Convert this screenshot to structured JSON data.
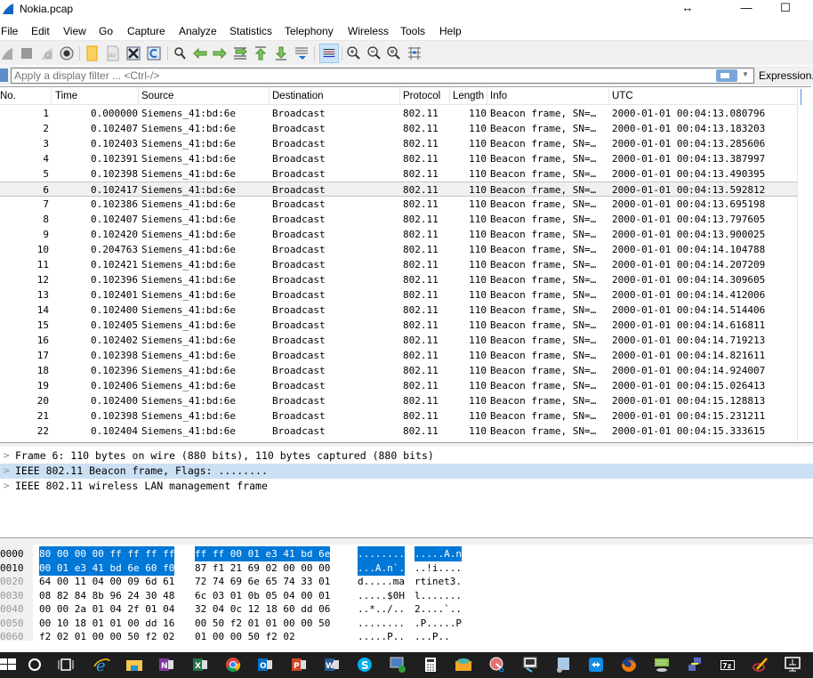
{
  "window": {
    "title": "Nokia.pcap",
    "controls": {
      "resize_glyph": "↔",
      "minimize_glyph": "—",
      "maximize_glyph": "☐"
    }
  },
  "menu": [
    "File",
    "Edit",
    "View",
    "Go",
    "Capture",
    "Analyze",
    "Statistics",
    "Telephony",
    "Wireless",
    "Tools",
    "Help"
  ],
  "toolbar": {
    "icons": [
      "start-capture-icon",
      "stop-capture-icon",
      "restart-capture-icon",
      "capture-options-icon",
      "open-file-icon",
      "save-file-icon",
      "close-file-icon",
      "reload-file-icon",
      "find-packet-icon",
      "go-back-icon",
      "go-forward-icon",
      "go-to-packet-icon",
      "first-packet-icon",
      "last-packet-icon",
      "auto-scroll-icon",
      "colorize-icon",
      "zoom-in-icon",
      "zoom-out-icon",
      "normal-size-icon",
      "resize-columns-icon"
    ]
  },
  "filter": {
    "placeholder": "Apply a display filter ... <Ctrl-/>",
    "value": "",
    "expression_label": "Expression..."
  },
  "packet_list": {
    "columns": [
      "No.",
      "Time",
      "Source",
      "Destination",
      "Protocol",
      "Length",
      "Info",
      "UTC"
    ],
    "selected_index": 5,
    "rows": [
      {
        "no": "1",
        "time": "0.000000",
        "source": "Siemens_41:bd:6e",
        "destination": "Broadcast",
        "protocol": "802.11",
        "length": "110",
        "info": "Beacon frame, SN=…",
        "utc": "2000-01-01 00:04:13.080796"
      },
      {
        "no": "2",
        "time": "0.102407",
        "source": "Siemens_41:bd:6e",
        "destination": "Broadcast",
        "protocol": "802.11",
        "length": "110",
        "info": "Beacon frame, SN=…",
        "utc": "2000-01-01 00:04:13.183203"
      },
      {
        "no": "3",
        "time": "0.102403",
        "source": "Siemens_41:bd:6e",
        "destination": "Broadcast",
        "protocol": "802.11",
        "length": "110",
        "info": "Beacon frame, SN=…",
        "utc": "2000-01-01 00:04:13.285606"
      },
      {
        "no": "4",
        "time": "0.102391",
        "source": "Siemens_41:bd:6e",
        "destination": "Broadcast",
        "protocol": "802.11",
        "length": "110",
        "info": "Beacon frame, SN=…",
        "utc": "2000-01-01 00:04:13.387997"
      },
      {
        "no": "5",
        "time": "0.102398",
        "source": "Siemens_41:bd:6e",
        "destination": "Broadcast",
        "protocol": "802.11",
        "length": "110",
        "info": "Beacon frame, SN=…",
        "utc": "2000-01-01 00:04:13.490395"
      },
      {
        "no": "6",
        "time": "0.102417",
        "source": "Siemens_41:bd:6e",
        "destination": "Broadcast",
        "protocol": "802.11",
        "length": "110",
        "info": "Beacon frame, SN=…",
        "utc": "2000-01-01 00:04:13.592812"
      },
      {
        "no": "7",
        "time": "0.102386",
        "source": "Siemens_41:bd:6e",
        "destination": "Broadcast",
        "protocol": "802.11",
        "length": "110",
        "info": "Beacon frame, SN=…",
        "utc": "2000-01-01 00:04:13.695198"
      },
      {
        "no": "8",
        "time": "0.102407",
        "source": "Siemens_41:bd:6e",
        "destination": "Broadcast",
        "protocol": "802.11",
        "length": "110",
        "info": "Beacon frame, SN=…",
        "utc": "2000-01-01 00:04:13.797605"
      },
      {
        "no": "9",
        "time": "0.102420",
        "source": "Siemens_41:bd:6e",
        "destination": "Broadcast",
        "protocol": "802.11",
        "length": "110",
        "info": "Beacon frame, SN=…",
        "utc": "2000-01-01 00:04:13.900025"
      },
      {
        "no": "10",
        "time": "0.204763",
        "source": "Siemens_41:bd:6e",
        "destination": "Broadcast",
        "protocol": "802.11",
        "length": "110",
        "info": "Beacon frame, SN=…",
        "utc": "2000-01-01 00:04:14.104788"
      },
      {
        "no": "11",
        "time": "0.102421",
        "source": "Siemens_41:bd:6e",
        "destination": "Broadcast",
        "protocol": "802.11",
        "length": "110",
        "info": "Beacon frame, SN=…",
        "utc": "2000-01-01 00:04:14.207209"
      },
      {
        "no": "12",
        "time": "0.102396",
        "source": "Siemens_41:bd:6e",
        "destination": "Broadcast",
        "protocol": "802.11",
        "length": "110",
        "info": "Beacon frame, SN=…",
        "utc": "2000-01-01 00:04:14.309605"
      },
      {
        "no": "13",
        "time": "0.102401",
        "source": "Siemens_41:bd:6e",
        "destination": "Broadcast",
        "protocol": "802.11",
        "length": "110",
        "info": "Beacon frame, SN=…",
        "utc": "2000-01-01 00:04:14.412006"
      },
      {
        "no": "14",
        "time": "0.102400",
        "source": "Siemens_41:bd:6e",
        "destination": "Broadcast",
        "protocol": "802.11",
        "length": "110",
        "info": "Beacon frame, SN=…",
        "utc": "2000-01-01 00:04:14.514406"
      },
      {
        "no": "15",
        "time": "0.102405",
        "source": "Siemens_41:bd:6e",
        "destination": "Broadcast",
        "protocol": "802.11",
        "length": "110",
        "info": "Beacon frame, SN=…",
        "utc": "2000-01-01 00:04:14.616811"
      },
      {
        "no": "16",
        "time": "0.102402",
        "source": "Siemens_41:bd:6e",
        "destination": "Broadcast",
        "protocol": "802.11",
        "length": "110",
        "info": "Beacon frame, SN=…",
        "utc": "2000-01-01 00:04:14.719213"
      },
      {
        "no": "17",
        "time": "0.102398",
        "source": "Siemens_41:bd:6e",
        "destination": "Broadcast",
        "protocol": "802.11",
        "length": "110",
        "info": "Beacon frame, SN=…",
        "utc": "2000-01-01 00:04:14.821611"
      },
      {
        "no": "18",
        "time": "0.102396",
        "source": "Siemens_41:bd:6e",
        "destination": "Broadcast",
        "protocol": "802.11",
        "length": "110",
        "info": "Beacon frame, SN=…",
        "utc": "2000-01-01 00:04:14.924007"
      },
      {
        "no": "19",
        "time": "0.102406",
        "source": "Siemens_41:bd:6e",
        "destination": "Broadcast",
        "protocol": "802.11",
        "length": "110",
        "info": "Beacon frame, SN=…",
        "utc": "2000-01-01 00:04:15.026413"
      },
      {
        "no": "20",
        "time": "0.102400",
        "source": "Siemens_41:bd:6e",
        "destination": "Broadcast",
        "protocol": "802.11",
        "length": "110",
        "info": "Beacon frame, SN=…",
        "utc": "2000-01-01 00:04:15.128813"
      },
      {
        "no": "21",
        "time": "0.102398",
        "source": "Siemens_41:bd:6e",
        "destination": "Broadcast",
        "protocol": "802.11",
        "length": "110",
        "info": "Beacon frame, SN=…",
        "utc": "2000-01-01 00:04:15.231211"
      },
      {
        "no": "22",
        "time": "0.102404",
        "source": "Siemens_41:bd:6e",
        "destination": "Broadcast",
        "protocol": "802.11",
        "length": "110",
        "info": "Beacon frame, SN=…",
        "utc": "2000-01-01 00:04:15.333615"
      }
    ]
  },
  "details": [
    {
      "text": "Frame 6: 110 bytes on wire (880 bits), 110 bytes captured (880 bits)",
      "selected": false
    },
    {
      "text": "IEEE 802.11 Beacon frame, Flags: ........",
      "selected": true
    },
    {
      "text": "IEEE 802.11 wireless LAN management frame",
      "selected": false
    }
  ],
  "bytes": [
    {
      "offset": "0000",
      "hex_a": "80 00 00 00 ff ff ff ff",
      "hex_b": "ff ff 00 01 e3 41 bd 6e",
      "ascii_a": "........",
      "ascii_b": ".....A.n",
      "hl_hex_a": true,
      "hl_hex_b": true,
      "hl_asc_a": true,
      "hl_asc_b": true
    },
    {
      "offset": "0010",
      "hex_a": "00 01 e3 41 bd 6e 60 f0",
      "hex_b": "87 f1 21 69 02 00 00 00",
      "ascii_a": "...A.n`.",
      "ascii_b": "..!i....",
      "hl_hex_a": true,
      "hl_hex_b": false,
      "hl_asc_a": true,
      "hl_asc_b": false
    },
    {
      "offset": "0020",
      "hex_a": "64 00 11 04 00 09 6d 61",
      "hex_b": "72 74 69 6e 65 74 33 01",
      "ascii_a": "d.....ma",
      "ascii_b": "rtinet3.",
      "hl_hex_a": false,
      "hl_hex_b": false,
      "hl_asc_a": false,
      "hl_asc_b": false
    },
    {
      "offset": "0030",
      "hex_a": "08 82 84 8b 96 24 30 48",
      "hex_b": "6c 03 01 0b 05 04 00 01",
      "ascii_a": ".....$0H",
      "ascii_b": "l.......",
      "hl_hex_a": false,
      "hl_hex_b": false,
      "hl_asc_a": false,
      "hl_asc_b": false
    },
    {
      "offset": "0040",
      "hex_a": "00 00 2a 01 04 2f 01 04",
      "hex_b": "32 04 0c 12 18 60 dd 06",
      "ascii_a": "..*../..",
      "ascii_b": "2....`..",
      "hl_hex_a": false,
      "hl_hex_b": false,
      "hl_asc_a": false,
      "hl_asc_b": false
    },
    {
      "offset": "0050",
      "hex_a": "00 10 18 01 01 00 dd 16",
      "hex_b": "00 50 f2 01 01 00 00 50",
      "ascii_a": "........",
      "ascii_b": ".P.....P",
      "hl_hex_a": false,
      "hl_hex_b": false,
      "hl_asc_a": false,
      "hl_asc_b": false
    },
    {
      "offset": "0060",
      "hex_a": "f2 02 01 00 00 50 f2 02",
      "hex_b": "01 00 00 50 f2 02",
      "ascii_a": ".....P..",
      "ascii_b": "...P..",
      "hl_hex_a": false,
      "hl_hex_b": false,
      "hl_asc_a": false,
      "hl_asc_b": false
    }
  ],
  "taskbar": {
    "icons": [
      "windows-start-icon",
      "cortana-search-icon",
      "task-view-icon",
      "internet-explorer-icon",
      "file-explorer-icon",
      "onenote-icon",
      "excel-icon",
      "chrome-icon",
      "outlook-icon",
      "powerpoint-icon",
      "word-icon",
      "skype-icon",
      "remote-desktop-icon",
      "calculator-icon",
      "folder-app-icon",
      "snipping-tool-icon",
      "network-tool-icon",
      "file-tool-icon",
      "teamviewer-icon",
      "firefox-icon",
      "keyboard-app-icon",
      "network-connect-icon",
      "7zip-icon",
      "paint-tool-icon",
      "network-display-icon"
    ]
  },
  "colors": {
    "selection_blue": "#0078d7",
    "details_selected": "#cce0f4",
    "selected_row": "#f0f0f0",
    "taskbar": "#1f1f1f"
  }
}
